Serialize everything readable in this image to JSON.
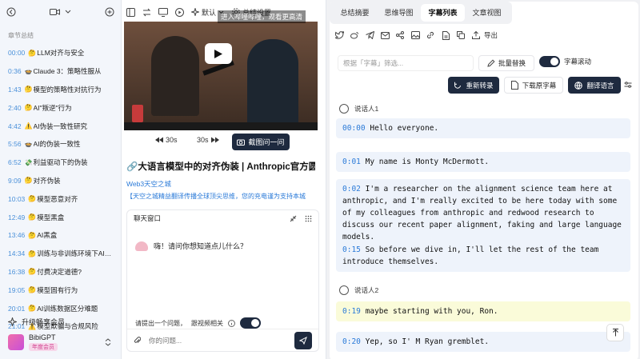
{
  "sidebar": {
    "section_title": "章节总结",
    "chapters": [
      {
        "time": "00:00",
        "emoji": "🤔",
        "label": "LLM对齐与安全"
      },
      {
        "time": "0:36",
        "emoji": "🍲",
        "label": "Claude 3：策略性服从"
      },
      {
        "time": "1:43",
        "emoji": "🤔",
        "label": "模型的策略性对抗行为"
      },
      {
        "time": "2:40",
        "emoji": "🤔",
        "label": "AI\"叛逆\"行为"
      },
      {
        "time": "4:42",
        "emoji": "⚠️",
        "label": "AI伪装一致性研究"
      },
      {
        "time": "5:56",
        "emoji": "🍲",
        "label": "AI的伪装一致性"
      },
      {
        "time": "6:52",
        "emoji": "💸",
        "label": "利益驱动下的伪装"
      },
      {
        "time": "9:09",
        "emoji": "🤔",
        "label": "对齐伪装"
      },
      {
        "time": "10:03",
        "emoji": "🤔",
        "label": "模型恶意对齐"
      },
      {
        "time": "12:49",
        "emoji": "🤔",
        "label": "模型黑盒"
      },
      {
        "time": "13:46",
        "emoji": "🤔",
        "label": "AI黑盒"
      },
      {
        "time": "14:34",
        "emoji": "🤔",
        "label": "训练与非训练环境下AI模..."
      },
      {
        "time": "16:38",
        "emoji": "🤔",
        "label": "付费决定道德?"
      },
      {
        "time": "19:05",
        "emoji": "🤔",
        "label": "模型固有行为"
      },
      {
        "time": "20:01",
        "emoji": "🤔",
        "label": "AI训练数据区分难题"
      },
      {
        "time": "21:01",
        "emoji": "⚠️",
        "label": "模型欺骗与合规风险"
      }
    ],
    "upgrade_label": "升级畅享会员",
    "user_name": "BibiGPT",
    "user_badge": "年度会员"
  },
  "middle": {
    "default_label": "默认",
    "settings_label": "总结设置",
    "video_banner": "进入哔哩哔哩，观看更高清",
    "rewind_label": "30s",
    "forward_label": "30s",
    "screenshot_label": "截图问一问",
    "video_title": "🔗大语言模型中的对齐伪装 | Anthropic官方圆桌...",
    "source": "Web3天空之城",
    "description": "【天空之城精益翻译传播全球顶尖思维，您的充电谨为支持本城",
    "chat_title": "聊天窗口",
    "chat_greeting": "嗨！请问你想知道点儿什么？",
    "question_prompt": "请提出一个问题，",
    "video_related": "跟视频相关",
    "input_placeholder": "你的问题..."
  },
  "right": {
    "tabs": [
      "总结摘要",
      "思维导图",
      "字幕列表",
      "文章视图"
    ],
    "active_tab": 2,
    "export_label": "导出",
    "filter_placeholder": "根据「字幕」筛选...",
    "batch_replace": "批量替换",
    "auto_scroll": "字幕滚动",
    "retranscribe": "重新转录",
    "download": "下载原字幕",
    "translate": "翻译语言",
    "speaker1": "说话人1",
    "speaker2": "说话人2",
    "segments": [
      {
        "time": "00:00",
        "text": "Hello everyone."
      },
      {
        "time": "0:01",
        "text": "My name is Monty McDermott."
      },
      {
        "time": "0:02",
        "text": "I'm a researcher on the alignment science team here at anthropic, and I'm really excited to be here today with some of my colleagues from anthropic and redwood research to discuss our recent paper alignment, faking and large language models."
      },
      {
        "time": "0:15",
        "text": "So before we dive in, I'll let the rest of the team introduce themselves."
      },
      {
        "time": "0:19",
        "text": "maybe starting with you, Ron."
      },
      {
        "time": "0:20",
        "text": "Yep, so I' M Ryan gremblet."
      }
    ]
  }
}
